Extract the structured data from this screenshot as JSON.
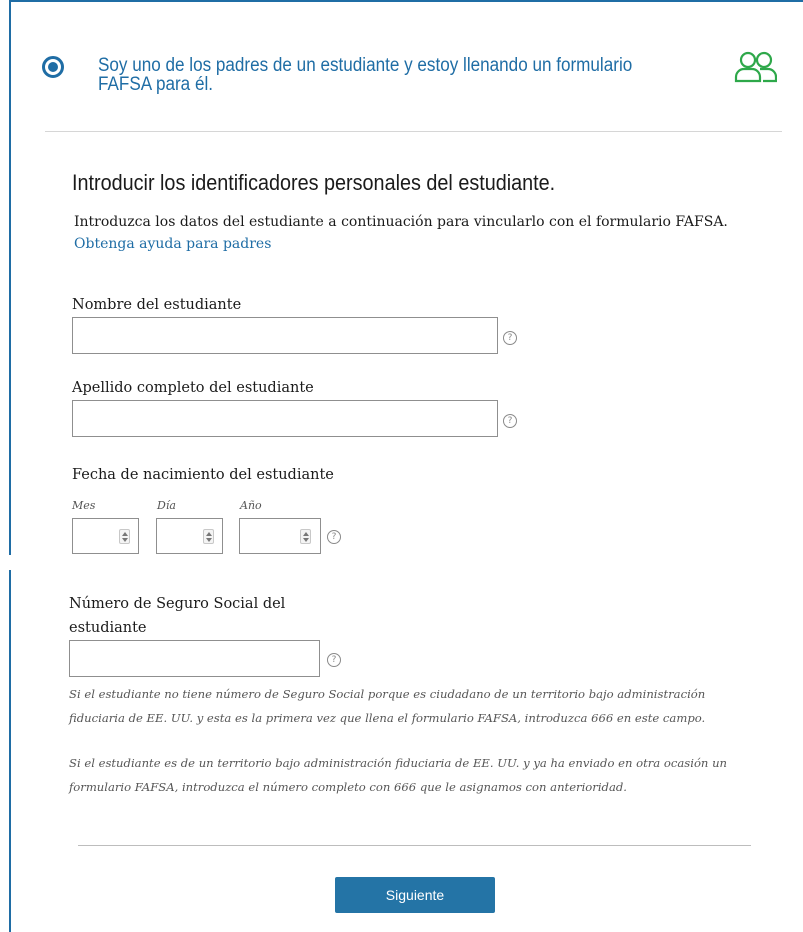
{
  "role_option": {
    "label": "Soy uno de los padres de un estudiante y estoy llenando un formulario FAFSA para él.",
    "selected": true,
    "icon": "people-icon",
    "icon_color": "#2ea84a"
  },
  "section": {
    "heading": "Introducir los identificadores personales del estudiante.",
    "intro": "Introduzca los datos del estudiante a continuación para vincularlo con el formulario FAFSA.",
    "help_link": "Obtenga ayuda para padres"
  },
  "fields": {
    "first_name": {
      "label": "Nombre del estudiante",
      "value": ""
    },
    "last_name": {
      "label": "Apellido completo del estudiante",
      "value": ""
    },
    "dob": {
      "label": "Fecha de nacimiento del estudiante",
      "month_label": "Mes",
      "day_label": "Día",
      "year_label": "Año",
      "month": "",
      "day": "",
      "year": ""
    },
    "ssn": {
      "label_line1": "Número de Seguro Social del",
      "label_line2": "estudiante",
      "value": "",
      "note1_line1": "Si el estudiante no tiene número de Seguro Social porque es ciudadano de un territorio bajo administración",
      "note1_line2": "fiduciaria de EE. UU. y esta es la primera vez que llena el formulario FAFSA, introduzca 666 en este campo.",
      "note2_line1": "Si el estudiante es de un territorio bajo administración fiduciaria de EE. UU. y ya ha enviado en otra ocasión un",
      "note2_line2": "formulario FAFSA, introduzca el número completo con 666 que le asignamos con anterioridad."
    }
  },
  "help_icon_glyph": "?",
  "next_button": {
    "label": "Siguiente"
  },
  "colors": {
    "primary": "#1f6da5",
    "button": "#2474a6",
    "accent_green": "#2ea84a"
  }
}
